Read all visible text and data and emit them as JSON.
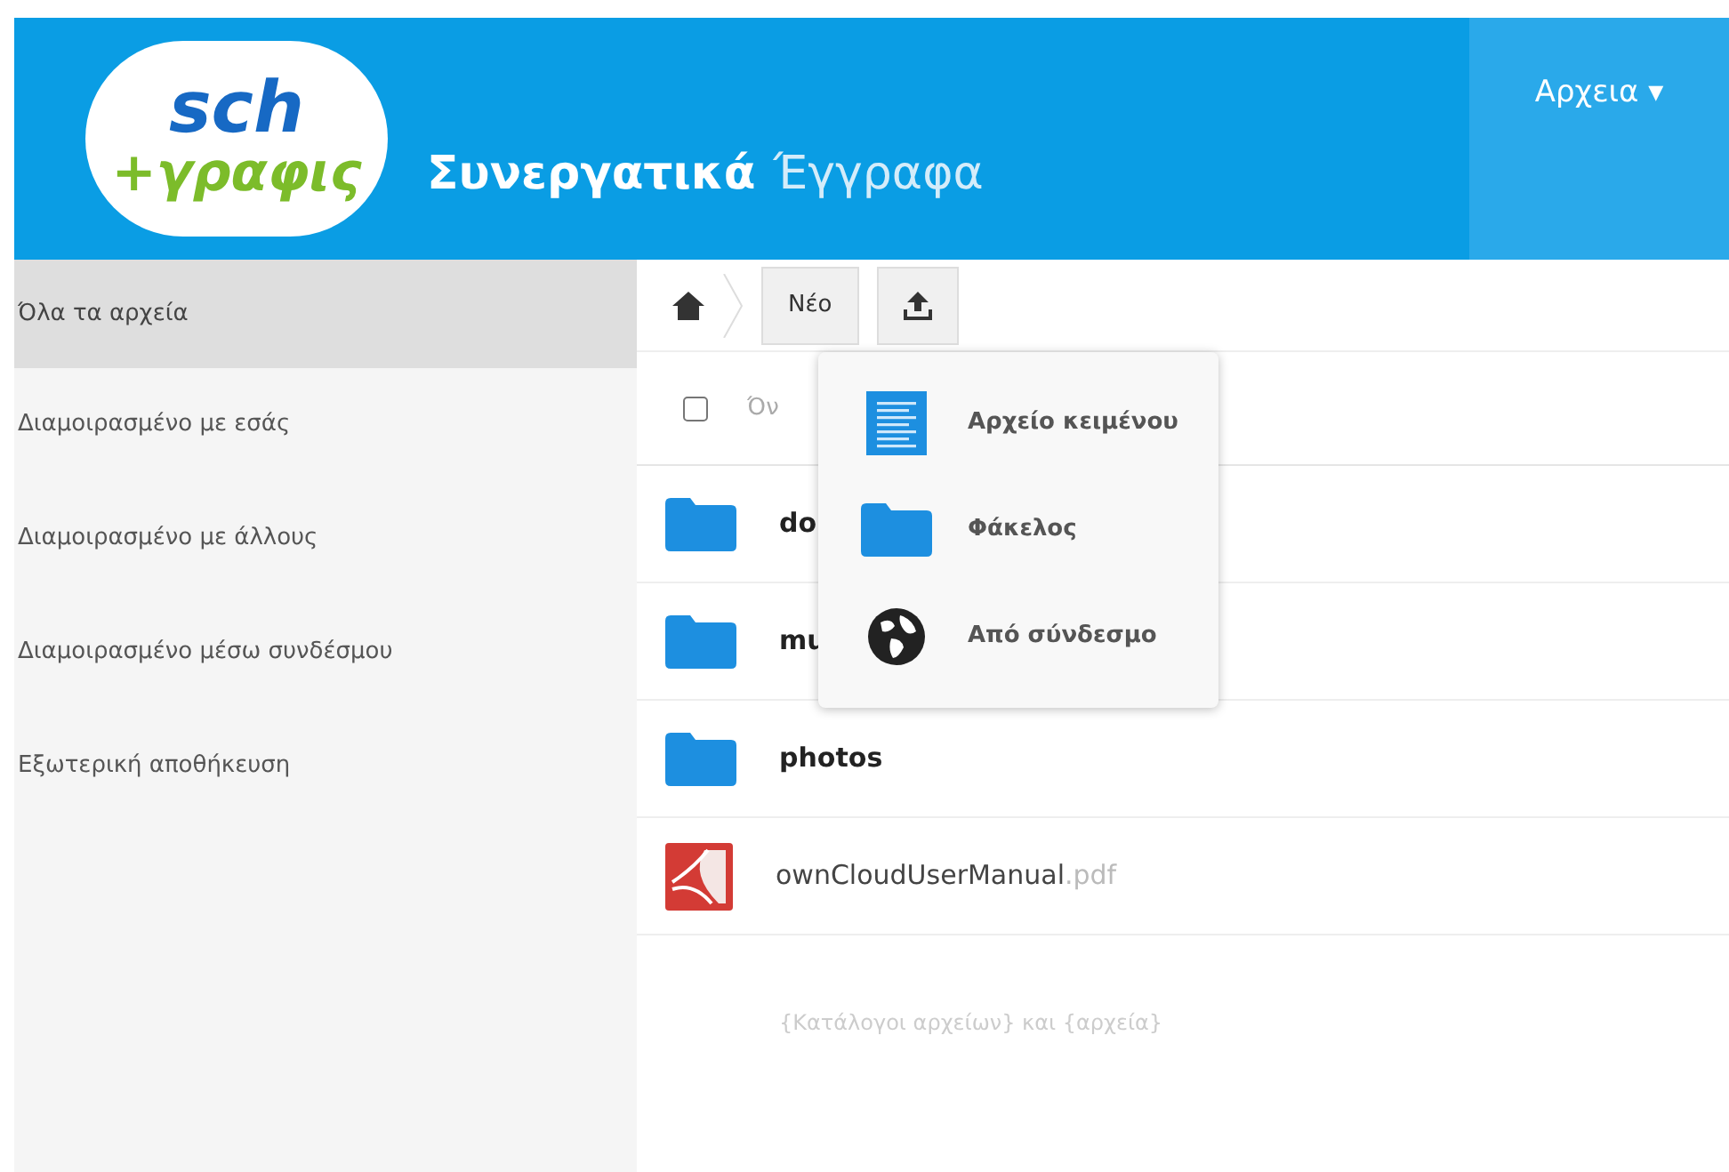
{
  "header": {
    "logo": {
      "top": "sch",
      "bottom": "+γραφις"
    },
    "title_bold": "Συνεργατικά",
    "title_light": "Έγγραφα",
    "app_menu": "Αρχεια ▾"
  },
  "sidebar": {
    "items": [
      {
        "label": "Όλα τα αρχεία",
        "selected": true
      },
      {
        "label": "Διαμοιρασμένο με εσάς",
        "selected": false
      },
      {
        "label": "Διαμοιρασμένο με άλλους",
        "selected": false
      },
      {
        "label": "Διαμοιρασμένο μέσω συνδέσμου",
        "selected": false
      },
      {
        "label": "Εξωτερική αποθήκευση",
        "selected": false
      }
    ]
  },
  "toolbar": {
    "new_button": "Νέο"
  },
  "table": {
    "select_all_checked": false,
    "name_column": "Όν",
    "rows": [
      {
        "kind": "folder",
        "name": "do",
        "extension": ""
      },
      {
        "kind": "folder",
        "name": "mu",
        "extension": ""
      },
      {
        "kind": "folder",
        "name": "photos",
        "extension": ""
      },
      {
        "kind": "pdf",
        "name": "ownCloudUserManual",
        "extension": ".pdf"
      }
    ],
    "summary": "{Κατάλογοι αρχείων} και {αρχεία}"
  },
  "new_menu": {
    "items": [
      {
        "kind": "text",
        "label": "Αρχείο κειμένου"
      },
      {
        "kind": "folder",
        "label": "Φάκελος"
      },
      {
        "kind": "link",
        "label": "Από σύνδεσμο"
      }
    ]
  }
}
